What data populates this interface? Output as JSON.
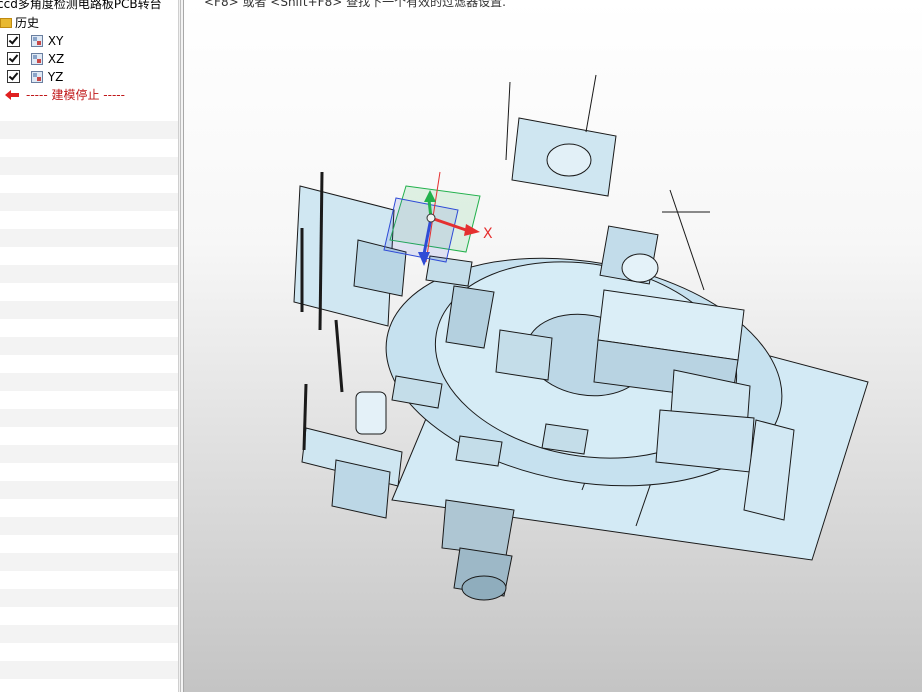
{
  "tree": {
    "root_label": "ccd多角度检测电路板PCB转台",
    "history_label": "历史",
    "planes": [
      {
        "label": "XY",
        "checked": true
      },
      {
        "label": "XZ",
        "checked": true
      },
      {
        "label": "YZ",
        "checked": true
      }
    ],
    "stop_label": "----- 建模停止 -----"
  },
  "viewport": {
    "hint": "<F8> 或者 <Shift+F8> 查找下一个有效的过滤器设置.",
    "axis_label_x": "X"
  },
  "colors": {
    "accent_red": "#c0181a",
    "model_fill": "#cde6f2",
    "model_line": "#1a1a1a",
    "handle_green": "#22b14c",
    "handle_red": "#e53030",
    "handle_blue": "#2f4bd6"
  }
}
